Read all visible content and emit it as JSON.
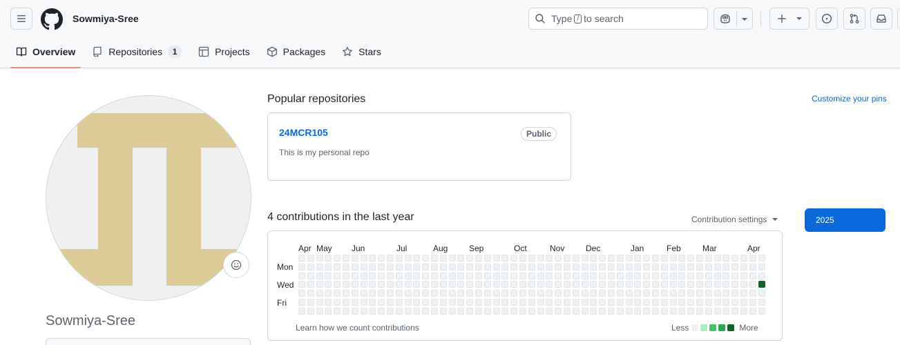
{
  "header": {
    "username": "Sowmiya-Sree",
    "search": {
      "prefix": "Type",
      "key": "/",
      "suffix": "to search"
    }
  },
  "tabs": [
    {
      "label": "Overview",
      "icon": "book-icon",
      "active": true
    },
    {
      "label": "Repositories",
      "icon": "repo-icon",
      "count": "1"
    },
    {
      "label": "Projects",
      "icon": "table-icon"
    },
    {
      "label": "Packages",
      "icon": "package-icon"
    },
    {
      "label": "Stars",
      "icon": "star-icon"
    }
  ],
  "profile": {
    "full_name": "Sowmiya-Sree",
    "avatar_colors": {
      "background": "#f0f0f0",
      "shape": "#dccb96"
    }
  },
  "popular": {
    "title": "Popular repositories",
    "customize": "Customize your pins",
    "repos": [
      {
        "name": "24MCR105",
        "badge": "Public",
        "description": "This is my personal repo"
      }
    ]
  },
  "contributions": {
    "title": "4 contributions in the last year",
    "settings": "Contribution settings",
    "months": [
      "Apr",
      "May",
      "Jun",
      "Jul",
      "Aug",
      "Sep",
      "Oct",
      "Nov",
      "Dec",
      "Jan",
      "Feb",
      "Mar",
      "Apr"
    ],
    "days": [
      "Mon",
      "Wed",
      "Fri"
    ],
    "learn": "Learn how we count contributions",
    "legend_less": "Less",
    "legend_more": "More",
    "levels": [
      "#eff2f5",
      "#aceebb",
      "#4ac26b",
      "#2da44e",
      "#116329"
    ],
    "weeks": 53,
    "active_cells": [
      {
        "week": 52,
        "day": 3,
        "level": 4
      }
    ],
    "year": "2025"
  }
}
